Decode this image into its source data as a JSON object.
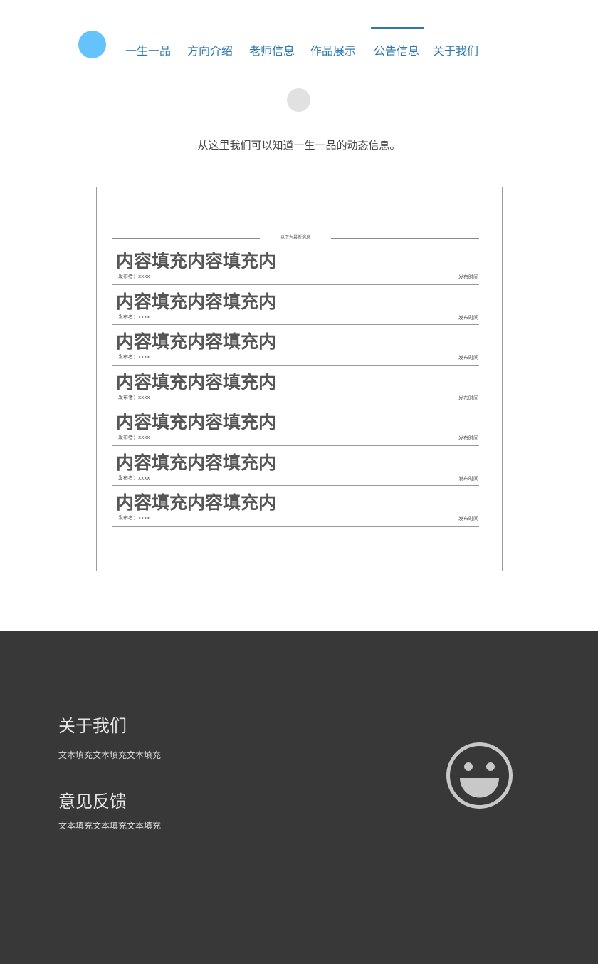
{
  "nav": {
    "items": [
      {
        "label": "一生一品"
      },
      {
        "label": "方向介绍"
      },
      {
        "label": "老师信息"
      },
      {
        "label": "作品展示"
      },
      {
        "label": "公告信息",
        "active": true
      },
      {
        "label": "关于我们"
      }
    ]
  },
  "intro": "从这里我们可以知道一生一品的动态信息。",
  "panel": {
    "latest_label": "以下为最新消息",
    "news": [
      {
        "title": "内容填充内容填充内",
        "author": "发布者：xxxx",
        "time": "发布时间"
      },
      {
        "title": "内容填充内容填充内",
        "author": "发布者：xxxx",
        "time": "发布时间"
      },
      {
        "title": "内容填充内容填充内",
        "author": "发布者：xxxx",
        "time": "发布时间"
      },
      {
        "title": "内容填充内容填充内",
        "author": "发布者：xxxx",
        "time": "发布时间"
      },
      {
        "title": "内容填充内容填充内",
        "author": "发布者：xxxx",
        "time": "发布时间"
      },
      {
        "title": "内容填充内容填充内",
        "author": "发布者：xxxx",
        "time": "发布时间"
      },
      {
        "title": "内容填充内容填充内",
        "author": "发布者：xxxx",
        "time": "发布时间"
      }
    ]
  },
  "footer": {
    "about_title": "关于我们",
    "about_text": "文本填充文本填充文本填充",
    "feedback_title": "意见反馈",
    "feedback_text": "文本填充文本填充文本填充",
    "icon": "smiley-icon"
  },
  "colors": {
    "accent": "#2d78ad",
    "logo": "#64c3fb",
    "footer_bg": "#383838"
  }
}
